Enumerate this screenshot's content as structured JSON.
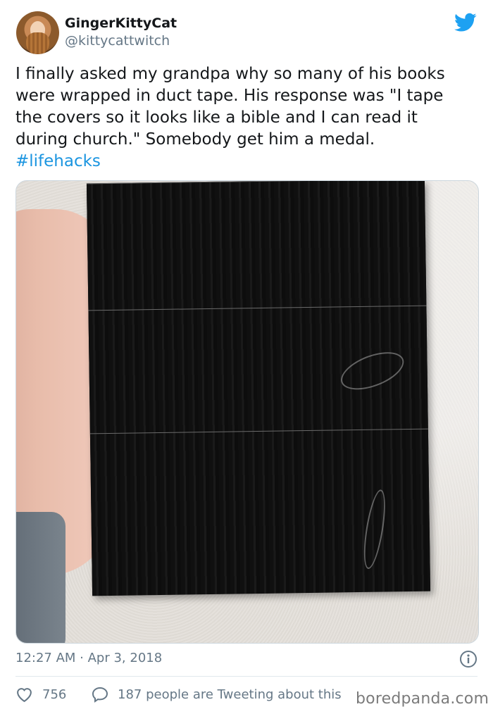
{
  "user": {
    "display_name": "GingerKittyCat",
    "handle": "@kittycattwitch"
  },
  "tweet": {
    "text": "I finally asked my grandpa why so many of his books\nwere wrapped in duct tape. His response was \"I tape\nthe covers so it looks like a bible and I can read it\nduring church.\" Somebody get him a medal.",
    "hashtag": "#lifehacks",
    "timestamp": "12:27 AM · Apr 3, 2018"
  },
  "stats": {
    "likes": "756",
    "activity": "187 people are Tweeting about this"
  },
  "watermark": "boredpanda.com",
  "colors": {
    "twitter_blue": "#1da1f2",
    "hashtag": "#1b95e0",
    "secondary_text": "#657786"
  },
  "icons": {
    "brand": "twitter-bird-icon",
    "info": "info-icon",
    "like": "heart-icon",
    "reply": "speech-bubble-icon"
  }
}
